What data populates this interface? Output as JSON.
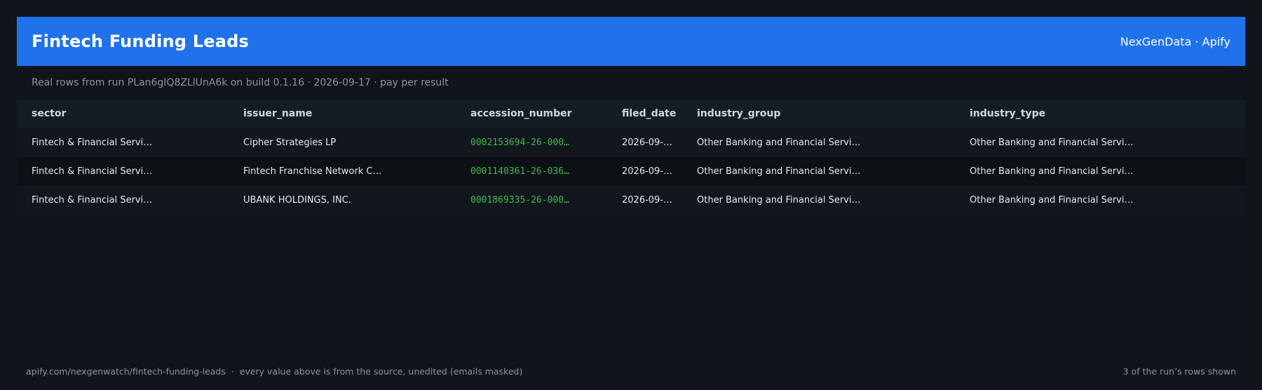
{
  "header": {
    "title": "Fintech Funding Leads",
    "brand": "NexGenData · Apify",
    "accent_color": "#2072ea"
  },
  "meta_line": "Real rows from run PLan6gIQ8ZLlUnA6k on build 0.1.16 · 2026-09-17 · pay per result",
  "table": {
    "columns": [
      "sector",
      "issuer_name",
      "accession_number",
      "filed_date",
      "industry_group",
      "industry_type"
    ],
    "rows": [
      [
        "Fintech & Financial Servi…",
        "Cipher Strategies LP",
        "0002153694-26-000…",
        "2026-09-…",
        "Other Banking and Financial Servi…",
        "Other Banking and Financial Servi…"
      ],
      [
        "Fintech & Financial Servi…",
        "Fintech Franchise Network C…",
        "0001140361-26-036…",
        "2026-09-…",
        "Other Banking and Financial Servi…",
        "Other Banking and Financial Servi…"
      ],
      [
        "Fintech & Financial Servi…",
        "UBANK HOLDINGS, INC.",
        "0001869335-26-000…",
        "2026-09-…",
        "Other Banking and Financial Servi…",
        "Other Banking and Financial Servi…"
      ]
    ]
  },
  "footer": {
    "left": "apify.com/nexgenwatch/fintech-funding-leads  ·  every value above is from the source, unedited (emails masked)",
    "right": "3 of the run’s rows shown"
  }
}
